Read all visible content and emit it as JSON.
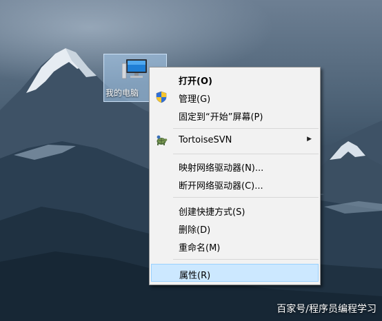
{
  "desktop": {
    "icon_label": "我的电脑",
    "watermark": "百家号/程序员编程学习"
  },
  "menu": {
    "items": [
      {
        "label": "打开(O)",
        "icon": null
      },
      {
        "label": "管理(G)",
        "icon": "shield-icon"
      },
      {
        "label": "固定到“开始”屏幕(P)",
        "icon": null
      },
      {
        "label": "TortoiseSVN",
        "icon": "tortoisesvn-icon",
        "submenu": true
      },
      {
        "label": "映射网络驱动器(N)...",
        "icon": null
      },
      {
        "label": "断开网络驱动器(C)...",
        "icon": null
      },
      {
        "label": "创建快捷方式(S)",
        "icon": null
      },
      {
        "label": "删除(D)",
        "icon": null
      },
      {
        "label": "重命名(M)",
        "icon": null
      },
      {
        "label": "属性(R)",
        "icon": null,
        "highlighted": true
      }
    ],
    "submenu_arrow": "▶"
  },
  "colors": {
    "highlight": "#cce8ff",
    "highlight_border": "#99d1ff",
    "menu_background": "#f2f2f2"
  }
}
